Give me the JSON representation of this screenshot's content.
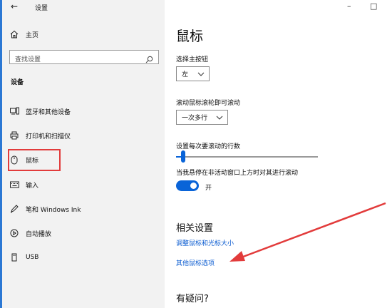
{
  "titlebar": {
    "back": "←",
    "title": "设置",
    "minimize": "–",
    "maximize": "□"
  },
  "sidebar": {
    "home": "主页",
    "search_placeholder": "查找设置",
    "section": "设备",
    "items": [
      {
        "label": "蓝牙和其他设备",
        "icon": "bluetooth-devices-icon"
      },
      {
        "label": "打印机和扫描仪",
        "icon": "printer-icon"
      },
      {
        "label": "鼠标",
        "icon": "mouse-icon"
      },
      {
        "label": "输入",
        "icon": "keyboard-icon"
      },
      {
        "label": "笔和 Windows Ink",
        "icon": "pen-icon"
      },
      {
        "label": "自动播放",
        "icon": "autoplay-icon"
      },
      {
        "label": "USB",
        "icon": "usb-icon"
      }
    ]
  },
  "main": {
    "title": "鼠标",
    "primary_button_label": "选择主按钮",
    "primary_button_value": "左",
    "wheel_label": "滚动鼠标滚轮即可滚动",
    "wheel_value": "一次多行",
    "lines_label": "设置每次要滚动的行数",
    "lines_level": 0.05,
    "inactive_scroll_label": "当我悬停在非活动窗口上方时对其进行滚动",
    "toggle_state": "开",
    "related_title": "相关设置",
    "link_cursor": "调整鼠标和光标大小",
    "link_other": "其他鼠标选项",
    "help_title": "有疑问?"
  },
  "colors": {
    "accent": "#0a64d8",
    "highlight": "#e23b3b",
    "link": "#0a5bd0"
  }
}
